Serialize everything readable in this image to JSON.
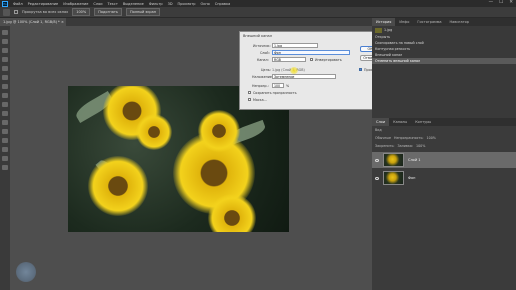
{
  "menubar": {
    "logo": "Ps",
    "items": [
      "Файл",
      "Редактирование",
      "Изображение",
      "Слои",
      "Текст",
      "Выделение",
      "Фильтр",
      "3D",
      "Просмотр",
      "Окно",
      "Справка"
    ],
    "window_controls": [
      "—",
      "☐",
      "✕"
    ]
  },
  "options_bar": {
    "checkbox_label": "Прокрутка во всех окнах",
    "zoom_value": "100%",
    "fit_button": "Подогнать",
    "fullscreen_button": "Полный экран"
  },
  "document": {
    "tab_title": "1.jpg @ 100% (Слой 1, RGB/8) *",
    "close_glyph": "×"
  },
  "dialog": {
    "title": "Внешний канал",
    "close_glyph": "×",
    "source_label": "Источник:",
    "source_value": "1.jpg",
    "layer_label": "Слой:",
    "layer_value": "Фон",
    "channel_label": "Канал:",
    "channel_value": "RGB",
    "invert_label": "Инвертировать",
    "target_label": "Цель:",
    "target_value": "1.jpg (Слой 1, RGB)",
    "blending_label": "Наложение:",
    "blending_value": "Затемнение",
    "opacity_label": "Непрозр.:",
    "opacity_value": "100",
    "opacity_unit": "%",
    "preserve_label": "Сохранить прозрачность",
    "mask_label": "Маска...",
    "ok_label": "ОК",
    "cancel_label": "Отмена",
    "preview_label": "Просмотр"
  },
  "history_panel": {
    "tabs": [
      "История",
      "Инфо",
      "Гистограмма",
      "Навигатор"
    ],
    "active_tab": "История",
    "snapshot_name": "1.jpg",
    "items": [
      "Открыть",
      "Скопировать на новый слой",
      "Контурная резкость",
      "Внешний канал",
      "Отменить внешний канал"
    ],
    "selected_index": 4
  },
  "layers_panel": {
    "tabs": [
      "Слои",
      "Каналы",
      "Контуры"
    ],
    "active_tab": "Слои",
    "kind_filter": "Вид",
    "blend_mode": "Обычные",
    "opacity_label": "Непрозрачность:",
    "opacity_value": "100%",
    "lock_label": "Закрепить:",
    "fill_label": "Заливка:",
    "fill_value": "100%",
    "layers": [
      {
        "name": "Слой 1",
        "selected": true
      },
      {
        "name": "Фон",
        "selected": false
      }
    ]
  }
}
